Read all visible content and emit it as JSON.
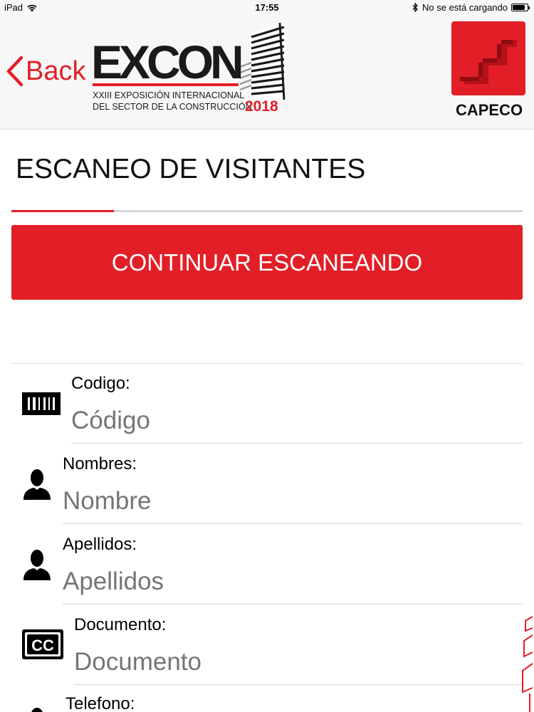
{
  "status_bar": {
    "device": "iPad",
    "time": "17:55",
    "charging_text": "No se está cargando",
    "battery_level": 0.85
  },
  "header": {
    "back_label": "Back",
    "excon_logo": {
      "word": "EXCON",
      "subtitle_line1": "XXIII EXPOSICIÓN  INTERNACIONAL",
      "subtitle_line2": "DEL SECTOR DE LA CONSTRUCCIÓN",
      "year": "2018"
    },
    "capeco_logo": {
      "name": "CAPECO"
    }
  },
  "page": {
    "title": "ESCANEO DE VISITANTES",
    "continue_button": "CONTINUAR ESCANEANDO"
  },
  "form": {
    "fields": [
      {
        "label": "Codigo:",
        "placeholder": "Código",
        "icon": "barcode-icon"
      },
      {
        "label": "Nombres:",
        "placeholder": "Nombre",
        "icon": "person-icon"
      },
      {
        "label": "Apellidos:",
        "placeholder": "Apellidos",
        "icon": "person-icon"
      },
      {
        "label": "Documento:",
        "placeholder": "Documento",
        "icon": "cc-icon"
      },
      {
        "label": "Telefono:",
        "placeholder": "",
        "icon": "person-icon"
      }
    ]
  },
  "colors": {
    "accent": "#e21e26",
    "placeholder": "#a3a3a3",
    "divider": "#d6d6d6"
  }
}
